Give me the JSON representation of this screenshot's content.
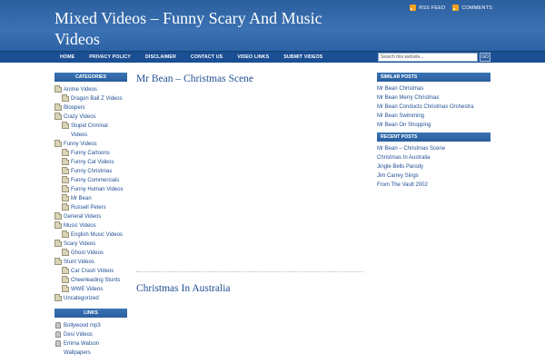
{
  "site": {
    "title": "Mixed Videos – Funny Scary And Music Videos",
    "rss_label": "RSS FEED",
    "comments_label": "COMMENTS"
  },
  "nav": {
    "items": [
      "HOME",
      "PRIVACY POLICY",
      "DISCLAIMER",
      "CONTACT US",
      "VIDEO LINKS",
      "SUBMIT VIDEOS"
    ],
    "search_placeholder": "Search this website...",
    "search_button": "GO"
  },
  "left_sidebar": {
    "categories_header": "CATEGORIES",
    "categories": [
      {
        "label": "Anime Videos",
        "level": 0
      },
      {
        "label": "Dragon Ball Z Videos",
        "level": 1
      },
      {
        "label": "Bloopers",
        "level": 0
      },
      {
        "label": "Crazy Videos",
        "level": 0
      },
      {
        "label": "Stupid Criminal Videos",
        "level": 1
      },
      {
        "label": "Funny Videos",
        "level": 0
      },
      {
        "label": "Funny Cartoons",
        "level": 1
      },
      {
        "label": "Funny Cat Videos",
        "level": 1
      },
      {
        "label": "Funny Christmas",
        "level": 1
      },
      {
        "label": "Funny Commercials",
        "level": 1
      },
      {
        "label": "Funny Human Videos",
        "level": 1
      },
      {
        "label": "Mr Bean",
        "level": 1
      },
      {
        "label": "Russell Peters",
        "level": 1
      },
      {
        "label": "General Videos",
        "level": 0
      },
      {
        "label": "Music Videos",
        "level": 0
      },
      {
        "label": "English Music Videos",
        "level": 1
      },
      {
        "label": "Scary Videos",
        "level": 0
      },
      {
        "label": "Ghost Videos",
        "level": 1
      },
      {
        "label": "Stunt Videos",
        "level": 0
      },
      {
        "label": "Car Crash Videos",
        "level": 1
      },
      {
        "label": "Cheerleading Stunts",
        "level": 1
      },
      {
        "label": "WWE Videos",
        "level": 1
      },
      {
        "label": "Uncategorized",
        "level": 0
      }
    ],
    "links_header": "LINKS",
    "links": [
      "Bollywood mp3",
      "Desi Videos",
      "Emma Watson Wallpapers"
    ]
  },
  "main": {
    "posts": [
      {
        "title": "Mr Bean – Christmas Scene"
      },
      {
        "title": "Christmas In Australia"
      }
    ]
  },
  "right_sidebar": {
    "similar_header": "SIMILAR POSTS",
    "similar": [
      "Mr Bean Christmas",
      "Mr Bean Merry Christmas",
      "Mr Bean Conducts Christmas Orchestra",
      "Mr Bean Swimming",
      "Mr Bean On Shopping"
    ],
    "recent_header": "RECENT POSTS",
    "recent": [
      "Mr Bean – Christmas Scene",
      "Christmas In Australia",
      "Jingle Bells Parody",
      "Jim Carrey Sings",
      "From The Vault 2002"
    ]
  }
}
